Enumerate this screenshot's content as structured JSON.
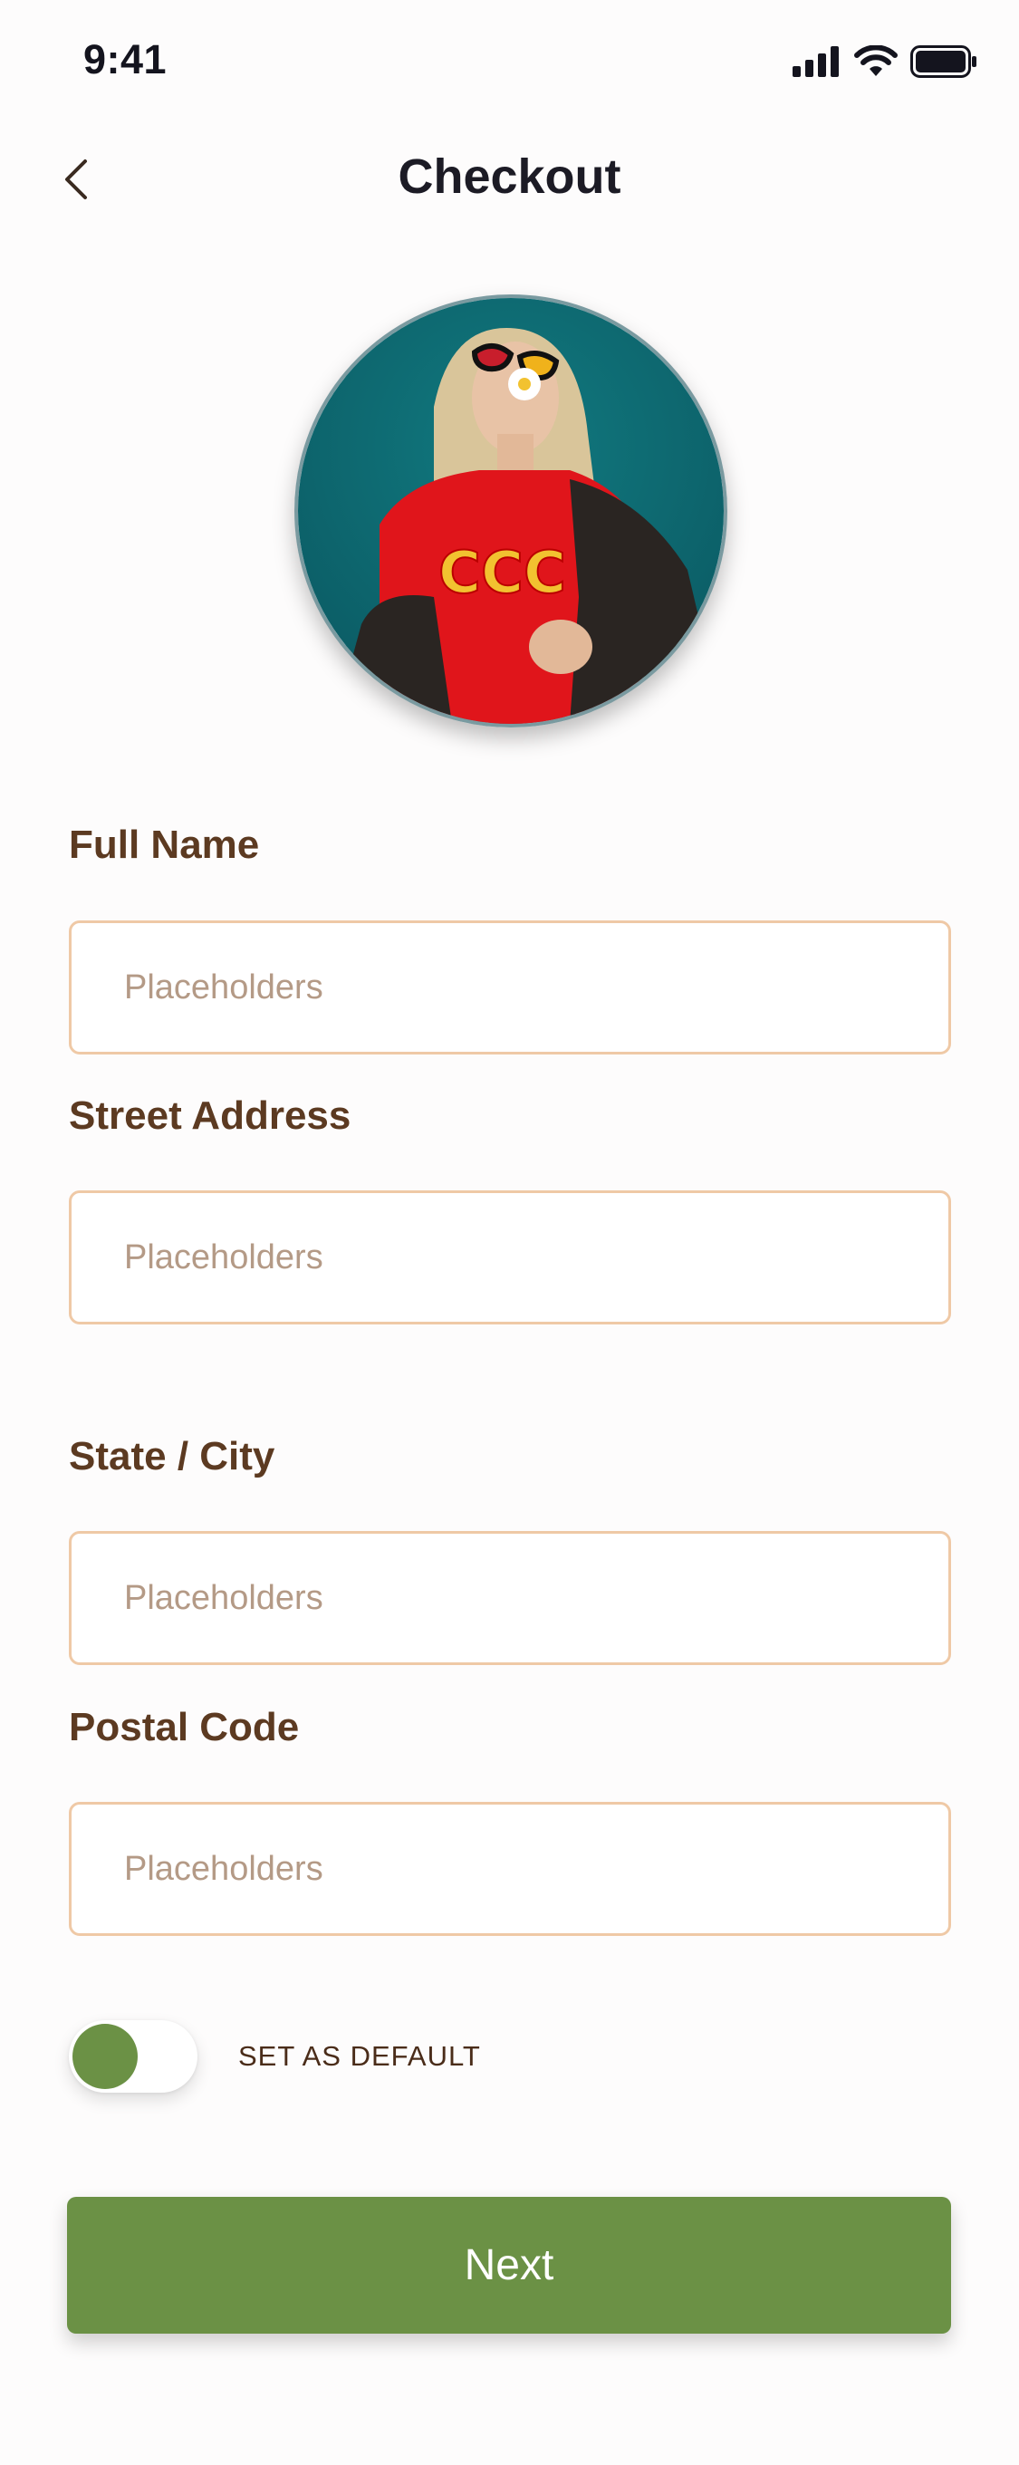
{
  "status_bar": {
    "time": "9:41",
    "icons": [
      "cellular-signal-icon",
      "wifi-icon",
      "battery-icon"
    ]
  },
  "header": {
    "title": "Checkout",
    "back_icon": "chevron-left-icon"
  },
  "form": {
    "full_name": {
      "label": "Full Name",
      "placeholder": "Placeholders",
      "value": ""
    },
    "street_address": {
      "label": "Street Address",
      "placeholder": "Placeholders",
      "value": ""
    },
    "state_city": {
      "label": "State / City",
      "placeholder": "Placeholders",
      "value": ""
    },
    "postal_code": {
      "label": "Postal Code",
      "placeholder": "Placeholders",
      "value": ""
    },
    "default_toggle": {
      "label": "SET AS DEFAULT",
      "on": false
    }
  },
  "actions": {
    "next_label": "Next"
  },
  "colors": {
    "accent": "#6b9145",
    "label": "#5c3a21",
    "field_border": "#efc9a6",
    "placeholder": "#b49a86",
    "title": "#1c1b25"
  }
}
